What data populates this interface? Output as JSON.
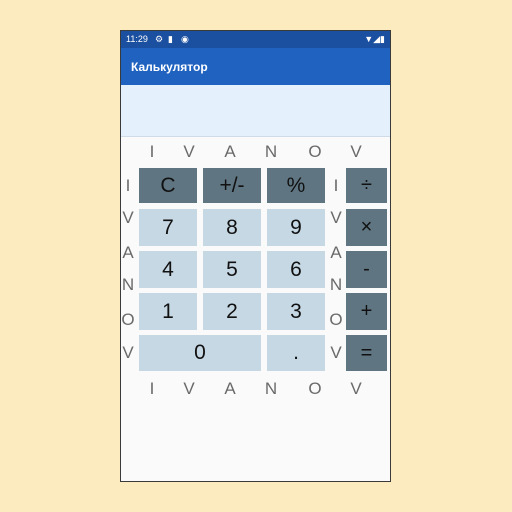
{
  "status_bar": {
    "time": "11:29",
    "icons_left": [
      "settings-icon",
      "sd-card-icon",
      "data-saver-icon"
    ],
    "icons_right": [
      "wifi-icon",
      "signal-icon",
      "battery-icon"
    ]
  },
  "toolbar": {
    "title": "Калькулятор"
  },
  "display": {
    "value": ""
  },
  "decor": {
    "top_row": [
      "I",
      "V",
      "A",
      "N",
      "O",
      "V"
    ],
    "bottom_row": [
      "I",
      "V",
      "A",
      "N",
      "O",
      "V"
    ],
    "left_col": [
      "I",
      "V",
      "A",
      "N",
      "O",
      "V"
    ],
    "right_col": [
      "I",
      "V",
      "A",
      "N",
      "O",
      "V"
    ]
  },
  "keys": {
    "clear": "C",
    "plus_minus": "+/-",
    "percent": "%",
    "divide": "÷",
    "seven": "7",
    "eight": "8",
    "nine": "9",
    "multiply": "×",
    "four": "4",
    "five": "5",
    "six": "6",
    "minus": "-",
    "one": "1",
    "two": "2",
    "three": "3",
    "plus": "+",
    "zero": "0",
    "dot": ".",
    "equals": "="
  },
  "colors": {
    "app_bar": "#1f62c0",
    "status_bar": "#1b4fa0",
    "display_bg": "#e4f0fc",
    "light_key": "#c6d8e4",
    "dark_key": "#5f7581",
    "outer_bg": "#fdebc0"
  }
}
